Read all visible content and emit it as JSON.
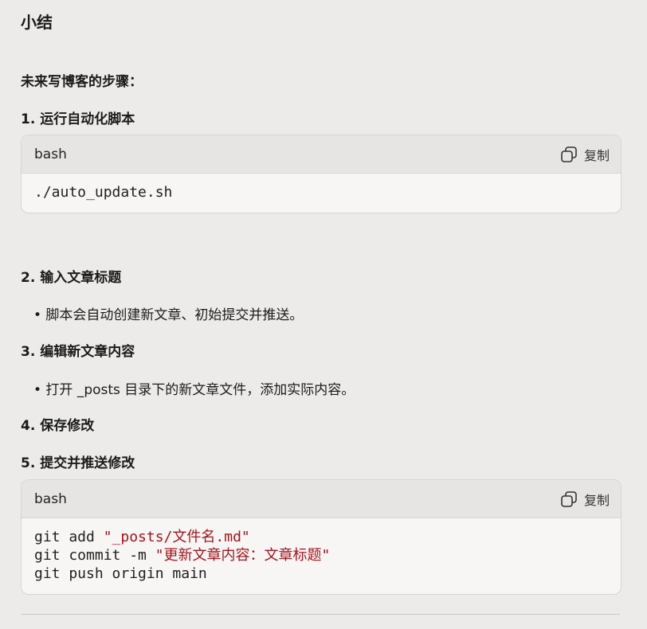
{
  "title": "小结",
  "subheading": "未来写博客的步骤：",
  "steps": [
    {
      "label": "1. 运行自动化脚本"
    },
    {
      "label": "2. 输入文章标题"
    },
    {
      "label": "3. 编辑新文章内容"
    },
    {
      "label": "4. 保存修改"
    },
    {
      "label": "5. 提交并推送修改"
    }
  ],
  "bullets": [
    "• 脚本会自动创建新文章、初始提交并推送。",
    "• 打开 _posts 目录下的新文章文件，添加实际内容。"
  ],
  "code_blocks": [
    {
      "lang": "bash",
      "copy_label": "复制",
      "lines": [
        {
          "text": "./auto_update.sh"
        }
      ]
    },
    {
      "lang": "bash",
      "copy_label": "复制",
      "lines": [
        {
          "plain": "git add ",
          "string": "\"_posts/文件名.md\""
        },
        {
          "plain": "git commit -m ",
          "string": "\"更新文章内容：文章标题\""
        },
        {
          "plain": "git push origin main",
          "string": ""
        }
      ]
    }
  ],
  "colors": {
    "background": "#ecebea",
    "code_string": "#a3151f"
  }
}
